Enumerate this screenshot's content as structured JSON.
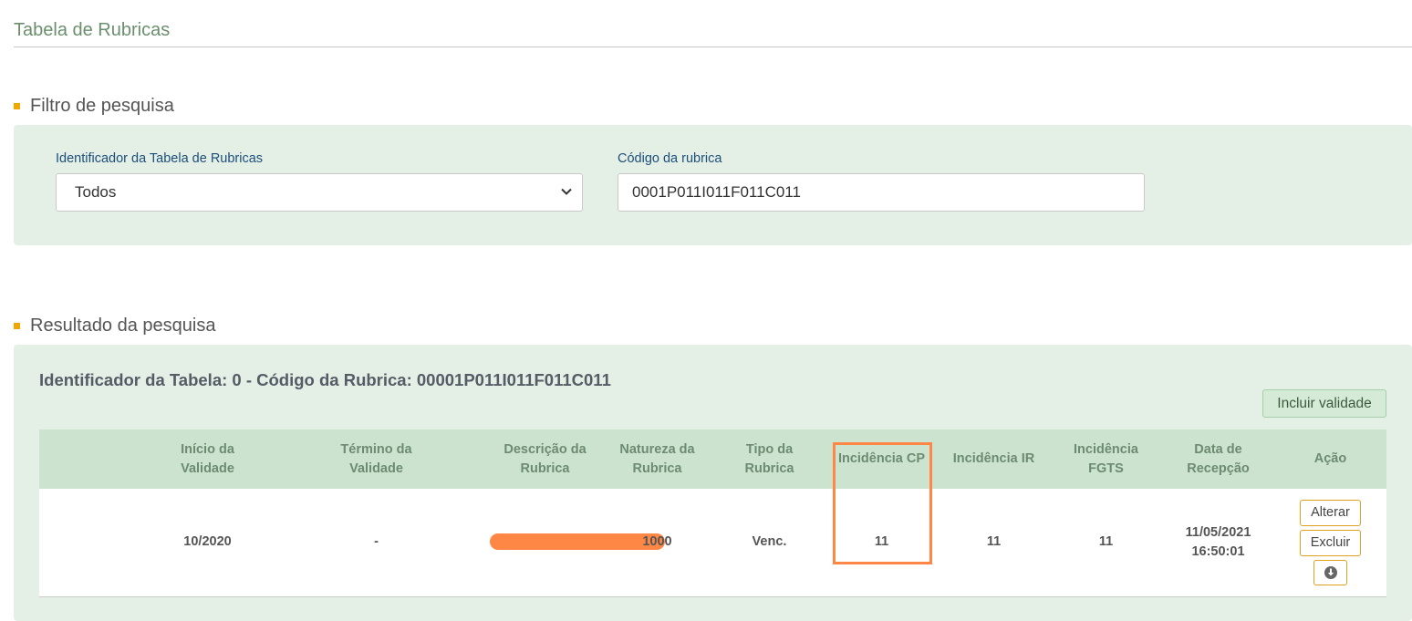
{
  "page": {
    "title": "Tabela de Rubricas"
  },
  "filter": {
    "heading": "Filtro de pesquisa",
    "identifier_label": "Identificador da Tabela de Rubricas",
    "identifier_value": "Todos",
    "code_label": "Código da rubrica",
    "code_value": "0001P011I011F011C011"
  },
  "results": {
    "heading": "Resultado da pesquisa",
    "title": "Identificador da Tabela: 0 - Código da Rubrica: 00001P011I011F011C011",
    "include_button": "Incluir validade",
    "columns": [
      [
        "Início da",
        "Validade"
      ],
      [
        "Término da",
        "Validade"
      ],
      [
        "Descrição da Rubrica"
      ],
      [
        "Natureza da",
        "Rubrica"
      ],
      [
        "Tipo da",
        "Rubrica"
      ],
      [
        "Incidência CP"
      ],
      [
        "Incidência IR"
      ],
      [
        "Incidência",
        "FGTS"
      ],
      [
        "Data de",
        "Recepção"
      ],
      [
        "Ação"
      ]
    ],
    "row": {
      "inicio": "10/2020",
      "termino": "-",
      "natureza": "1000",
      "tipo": "Venc.",
      "incidencia_cp": "11",
      "incidencia_ir": "11",
      "incidencia_fgts": "11",
      "data_recepcao_date": "11/05/2021",
      "data_recepcao_time": "16:50:01",
      "alterar": "Alterar",
      "excluir": "Excluir"
    }
  },
  "colors": {
    "accent_marker": "#f0a800",
    "panel_bg": "#e4efe6",
    "highlight": "#ff8745",
    "link_blue": "#1d4f7a"
  }
}
